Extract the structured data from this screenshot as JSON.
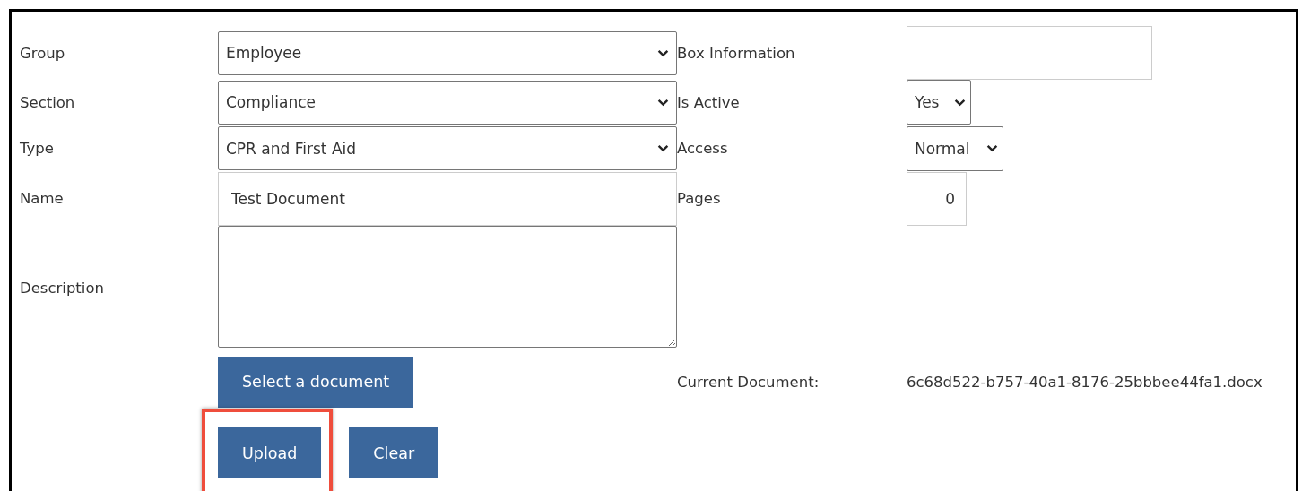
{
  "form_rows": [
    {
      "left": {
        "label": "Group",
        "kind": "select",
        "value": "Employee"
      },
      "right": {
        "label": "Box Information",
        "kind": "text"
      }
    },
    {
      "left": {
        "label": "Section",
        "kind": "select",
        "value": "Compliance"
      },
      "right": {
        "label": "Is Active",
        "kind": "select",
        "value": "Yes"
      }
    },
    {
      "left": {
        "label": "Type",
        "kind": "select",
        "value": "CPR and First Aid"
      },
      "right": {
        "label": "Access",
        "kind": "select",
        "value": "Normal"
      }
    },
    {
      "left": {
        "label": "Name",
        "kind": "text",
        "value": "Test Document"
      },
      "right": {
        "label": "Pages",
        "kind": "number",
        "value": "0"
      }
    },
    {
      "left": {
        "label": "Description",
        "kind": "textarea"
      }
    }
  ],
  "select_button": {
    "label": "Select a document"
  },
  "current_document": {
    "label": "Current Document:",
    "value": "6c68d522-b757-40a1-8176-25bbbee44fa1.docx"
  },
  "actions": [
    {
      "label": "Upload",
      "highlighted": true
    },
    {
      "label": "Clear",
      "highlighted": false
    }
  ]
}
